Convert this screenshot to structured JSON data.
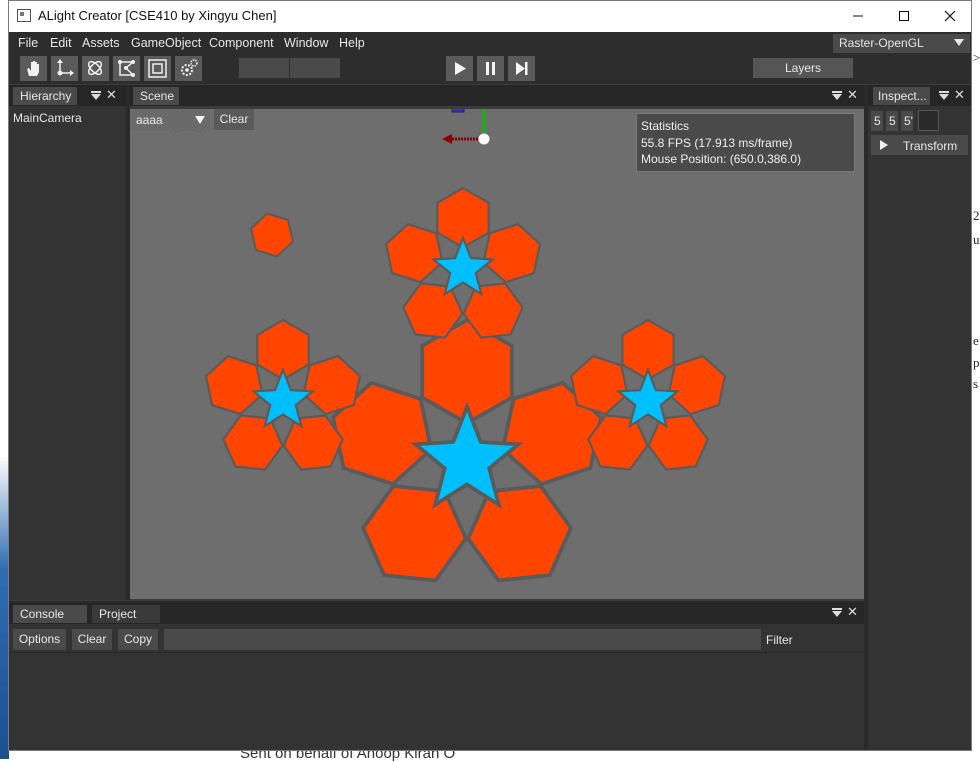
{
  "window": {
    "title": "ALight Creator [CSE410 by Xingyu Chen]"
  },
  "menu": [
    "File",
    "Edit",
    "Assets",
    "GameObject",
    "Component",
    "Window",
    "Help"
  ],
  "renderer": {
    "selected": "Raster-OpenGL"
  },
  "toolbar": {
    "tools": [
      "hand-tool-icon",
      "move-tool-icon",
      "rotate-tool-icon",
      "scale-tool-icon",
      "rect-tool-icon",
      "transform-tool-icon"
    ],
    "layers_label": "Layers"
  },
  "hierarchy": {
    "tab": "Hierarchy",
    "items": [
      "MainCamera"
    ]
  },
  "scene": {
    "tab": "Scene",
    "camera_select": "aaaa",
    "clear_label": "Clear",
    "stats": {
      "title": "Statistics",
      "fps": "55.8 FPS (17.913 ms/frame)",
      "mouse": "Mouse Position: (650.0,386.0)"
    },
    "colors": {
      "hexagon": "#ff4500",
      "star": "#00bfff",
      "outline": "#5a5a5a",
      "background": "#6e6e6e"
    }
  },
  "inspector": {
    "tab": "Inspect...",
    "fields": [
      "5",
      "5",
      "5'"
    ],
    "component": "Transform"
  },
  "console": {
    "tabs": [
      "Console",
      "Project"
    ],
    "buttons": [
      "Options",
      "Clear",
      "Copy"
    ],
    "filter_label": "Filter",
    "filter_value": ""
  },
  "background": {
    "doc_text": "Sent on behalf of Anoop Kiran O",
    "right_fragments": [
      "2",
      "u",
      ">",
      "e",
      "p",
      "s"
    ]
  }
}
